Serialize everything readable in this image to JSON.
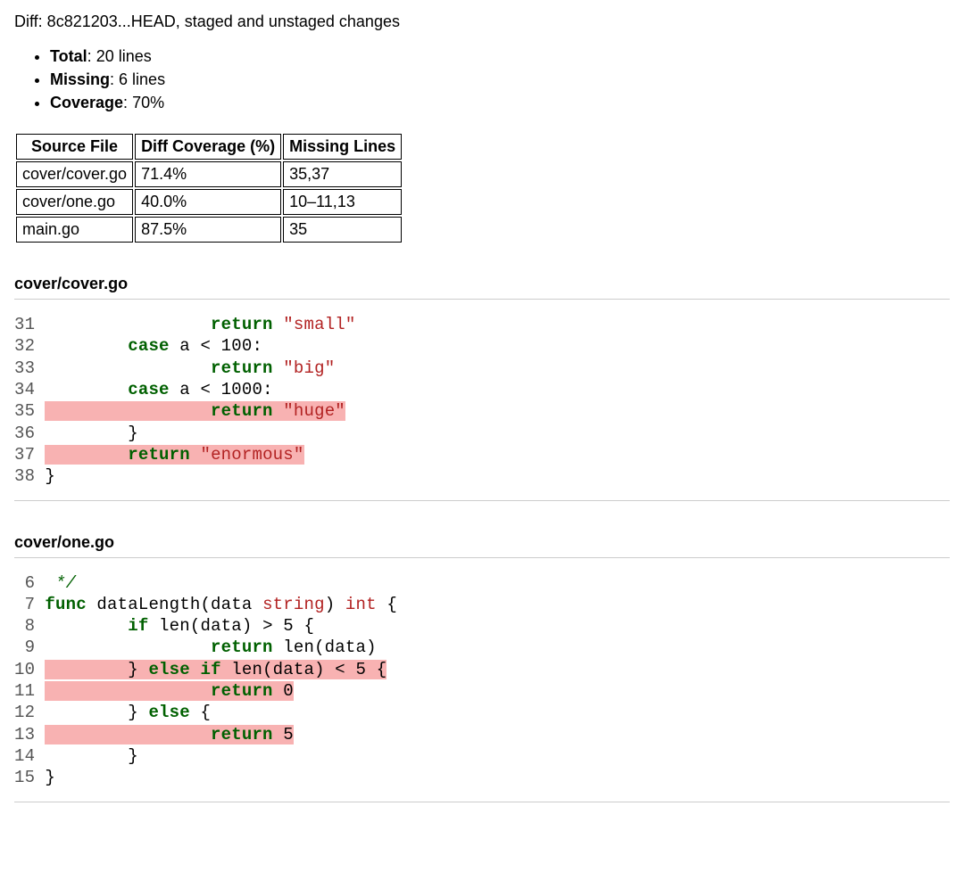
{
  "header": "Diff: 8c821203...HEAD, staged and unstaged changes",
  "summary": {
    "total_label": "Total",
    "total_value": "20 lines",
    "missing_label": "Missing",
    "missing_value": "6 lines",
    "coverage_label": "Coverage",
    "coverage_value": "70%"
  },
  "table": {
    "headers": {
      "file": "Source File",
      "cov": "Diff Coverage (%)",
      "miss": "Missing Lines"
    },
    "rows": [
      {
        "file": "cover/cover.go",
        "cov": "71.4%",
        "miss": "35,37"
      },
      {
        "file": "cover/one.go",
        "cov": "40.0%",
        "miss": "10–11,13"
      },
      {
        "file": "main.go",
        "cov": "87.5%",
        "miss": "35"
      }
    ]
  },
  "files": {
    "cover_go": {
      "name": "cover/cover.go",
      "lines": {
        "l31": {
          "n": "31",
          "lead": "                ",
          "kw": "return",
          "sp": " ",
          "str": "\"small\""
        },
        "l32": {
          "n": "32",
          "lead": "        ",
          "kw": "case",
          "rest": " a < 100:"
        },
        "l33": {
          "n": "33",
          "lead": "                ",
          "kw": "return",
          "sp": " ",
          "str": "\"big\""
        },
        "l34": {
          "n": "34",
          "lead": "        ",
          "kw": "case",
          "rest": " a < 1000:"
        },
        "l35": {
          "n": "35",
          "lead": "                ",
          "kw": "return",
          "sp": " ",
          "str": "\"huge\""
        },
        "l36": {
          "n": "36",
          "lead": "        ",
          "txt": "}"
        },
        "l37": {
          "n": "37",
          "lead": "        ",
          "kw": "return",
          "sp": " ",
          "str": "\"enormous\""
        },
        "l38": {
          "n": "38",
          "lead": "",
          "txt": "}"
        }
      }
    },
    "one_go": {
      "name": "cover/one.go",
      "lines": {
        "l6": {
          "n": " 6",
          "lead": " ",
          "cmt": "*/"
        },
        "l7": {
          "n": " 7",
          "kw": "func",
          "name": " dataLength(data ",
          "typ": "string",
          "tail": ") ",
          "typ2": "int",
          "brace": " {"
        },
        "l8": {
          "n": " 8",
          "lead": "        ",
          "kw": "if",
          "mid": " len(data) > 5 {",
          "rest": ""
        },
        "l9": {
          "n": " 9",
          "lead": "                ",
          "kw": "return",
          "tail": " len(data)"
        },
        "l10": {
          "n": "10",
          "lead": "        ",
          "txt1": "} ",
          "kw": "else if",
          "tail": " len(data) < 5 {"
        },
        "l11": {
          "n": "11",
          "lead": "                ",
          "kw": "return",
          "sp": " ",
          "num": "0"
        },
        "l12": {
          "n": "12",
          "lead": "        ",
          "txt1": "} ",
          "kw": "else",
          "brace": " {"
        },
        "l13": {
          "n": "13",
          "lead": "                ",
          "kw": "return",
          "sp": " ",
          "num": "5"
        },
        "l14": {
          "n": "14",
          "lead": "        ",
          "txt": "}"
        },
        "l15": {
          "n": "15",
          "lead": "",
          "txt": "}"
        }
      }
    }
  }
}
